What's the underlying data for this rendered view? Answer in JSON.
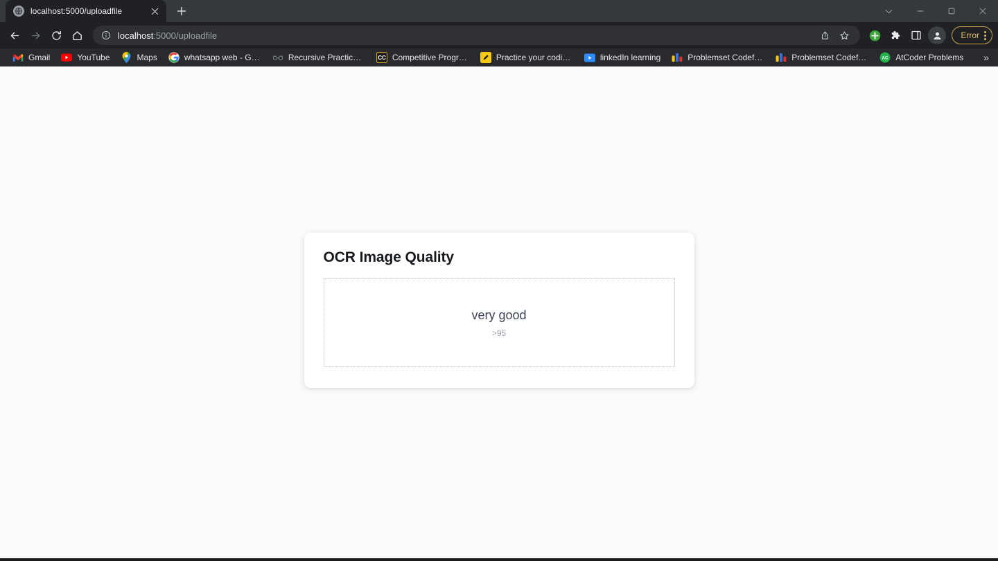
{
  "window": {
    "controls": [
      {
        "name": "minimize-to-tray",
        "icon": "chevron-down-icon"
      },
      {
        "name": "minimize",
        "icon": "minimize-icon"
      },
      {
        "name": "maximize",
        "icon": "maximize-icon"
      },
      {
        "name": "close",
        "icon": "close-icon"
      }
    ]
  },
  "tabs": [
    {
      "title": "localhost:5000/uploadfile",
      "favicon": "globe-icon",
      "active": true
    }
  ],
  "newtab_label": "+",
  "toolbar": {
    "back": "back-arrow-icon",
    "forward": "forward-arrow-icon",
    "reload": "reload-icon",
    "home": "home-icon",
    "omnibox": {
      "info_icon": "info-circle-icon",
      "url_host": "localhost",
      "url_path": ":5000/uploadfile",
      "full_url": "localhost:5000/uploadfile",
      "share_icon": "share-icon",
      "bookmark_icon": "star-icon"
    },
    "extensions": [
      {
        "name": "add-extension",
        "icon": "green-plus-icon",
        "color": "#3ea53c"
      },
      {
        "name": "extensions",
        "icon": "puzzle-piece-icon"
      },
      {
        "name": "side-panel",
        "icon": "side-panel-icon"
      }
    ],
    "profile": "profile-avatar-icon",
    "error_badge": {
      "label": "Error",
      "color": "#e3c06a",
      "menu_icon": "kebab-menu-icon"
    }
  },
  "bookmarks": {
    "items": [
      {
        "label": "Gmail",
        "icon": "gmail-icon"
      },
      {
        "label": "YouTube",
        "icon": "youtube-icon"
      },
      {
        "label": "Maps",
        "icon": "google-maps-icon"
      },
      {
        "label": "whatsapp web - Go...",
        "icon": "google-icon"
      },
      {
        "label": "Recursive Practice P...",
        "icon": "glasses-icon"
      },
      {
        "label": "Competitive Progra...",
        "icon": "cc-icon"
      },
      {
        "label": "Practice your codin...",
        "icon": "yellow-pencil-icon"
      },
      {
        "label": "linkedIn learning",
        "icon": "video-play-icon"
      },
      {
        "label": "Problemset Codefo...",
        "icon": "codeforces-icon"
      },
      {
        "label": "Problemset Codefo...",
        "icon": "codeforces-icon"
      },
      {
        "label": "AtCoder Problems",
        "icon": "atcoder-icon"
      }
    ],
    "overflow_label": "»"
  },
  "page": {
    "card": {
      "title": "OCR Image Quality",
      "quality_label": "very good",
      "quality_score": ">95"
    }
  }
}
